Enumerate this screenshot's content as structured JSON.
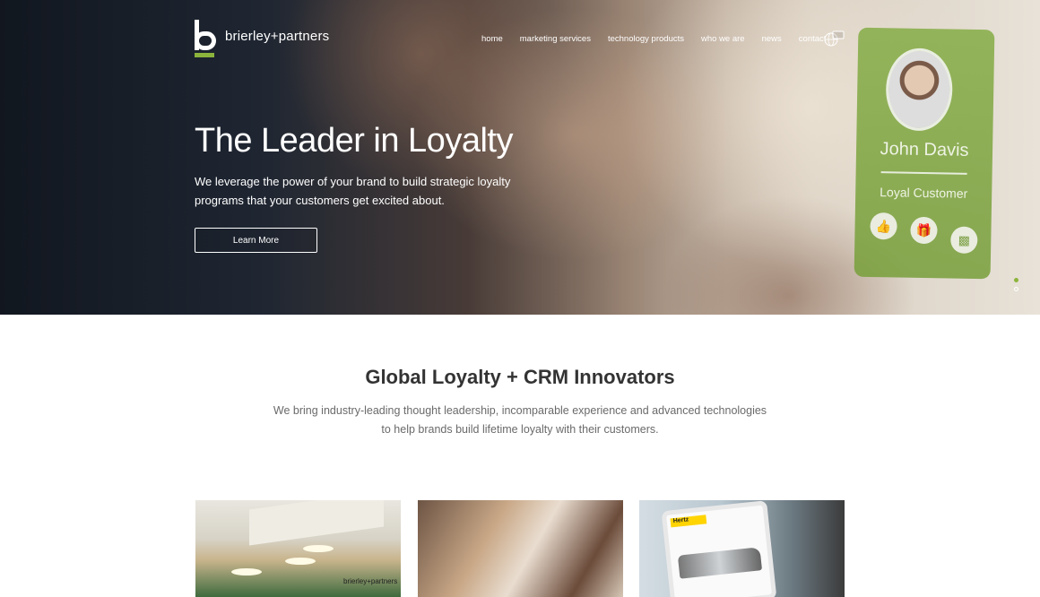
{
  "brand": {
    "name": "brierley+partners",
    "accent_color": "#8cb43c"
  },
  "nav": {
    "items": [
      "home",
      "marketing services",
      "technology products",
      "who we are",
      "news",
      "contact"
    ],
    "globe_icon": "globe-chat-icon"
  },
  "hero": {
    "title": "The Leader in Loyalty",
    "subtitle": "We leverage the power of your brand to build strategic loyalty programs that your customers get excited about.",
    "button_label": "Learn More",
    "card": {
      "name": "John Davis",
      "status": "Loyal Customer",
      "icons": [
        "thumbs-up-icon",
        "gift-icon",
        "bar-chart-icon"
      ]
    },
    "slides": 2,
    "active_slide": 1
  },
  "intro": {
    "title": "Global Loyalty + CRM Innovators",
    "text": "We bring industry-leading thought leadership, incomparable experience and advanced technologies to help brands build lifetime loyalty with their customers."
  },
  "tiles": {
    "office_sign": "brierley+partners",
    "tablet_brand": "Hertz"
  }
}
